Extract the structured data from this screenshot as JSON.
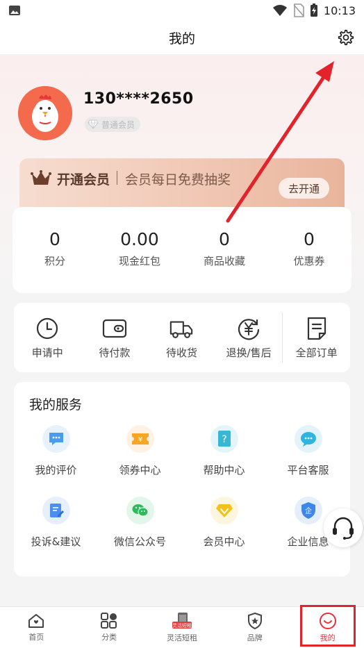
{
  "status_bar": {
    "time": "10:13",
    "icons": [
      "image-icon",
      "wifi-icon",
      "no-sim-icon",
      "battery-charging-icon"
    ]
  },
  "nav": {
    "title": "我的",
    "settings_icon": "gear-icon"
  },
  "profile": {
    "phone": "130****2650",
    "member_level": "普通会员",
    "avatar_icon": "chicken-mascot-icon"
  },
  "vip_banner": {
    "title": "开通会员",
    "subtitle": "会员每日免费抽奖",
    "button": "去开通",
    "icon": "crown-icon"
  },
  "stats": [
    {
      "value": "0",
      "label": "积分"
    },
    {
      "value": "0.00",
      "label": "现金红包"
    },
    {
      "value": "0",
      "label": "商品收藏"
    },
    {
      "value": "0",
      "label": "优惠券"
    }
  ],
  "orders": [
    {
      "label": "申请中",
      "icon": "clock-icon"
    },
    {
      "label": "待付款",
      "icon": "wallet-icon"
    },
    {
      "label": "待收货",
      "icon": "truck-icon"
    },
    {
      "label": "退换/售后",
      "icon": "yuan-refund-icon"
    },
    {
      "label": "全部订单",
      "icon": "order-list-icon"
    }
  ],
  "services": {
    "title": "我的服务",
    "items": [
      {
        "label": "我的评价",
        "icon": "chat-bubble-icon",
        "color": "#4a9cf0"
      },
      {
        "label": "领券中心",
        "icon": "coupon-icon",
        "color": "#f5a623"
      },
      {
        "label": "帮助中心",
        "icon": "help-book-icon",
        "color": "#37b7d6"
      },
      {
        "label": "平台客服",
        "icon": "service-chat-icon",
        "color": "#2fb4e0"
      },
      {
        "label": "投诉&建议",
        "icon": "edit-note-icon",
        "color": "#4a8ef0"
      },
      {
        "label": "微信公众号",
        "icon": "wechat-icon",
        "color": "#2dbb5a"
      },
      {
        "label": "会员中心",
        "icon": "vip-diamond-icon",
        "color": "#f2c21b"
      },
      {
        "label": "企业信息",
        "icon": "enterprise-shield-icon",
        "color": "#3d86ea"
      }
    ]
  },
  "tabs": [
    {
      "label": "首页",
      "icon": "home-icon",
      "active": false
    },
    {
      "label": "分类",
      "icon": "category-grid-icon",
      "active": false
    },
    {
      "label": "灵活短租",
      "icon": "rental-phone-icon",
      "badge": "灵活短租",
      "active": false
    },
    {
      "label": "品牌",
      "icon": "brand-badge-icon",
      "active": false
    },
    {
      "label": "我的",
      "icon": "smile-icon",
      "active": true
    }
  ],
  "colors": {
    "accent": "#e6313b",
    "vip_text": "#5a3a2c",
    "annotation_red": "#e3232b"
  }
}
